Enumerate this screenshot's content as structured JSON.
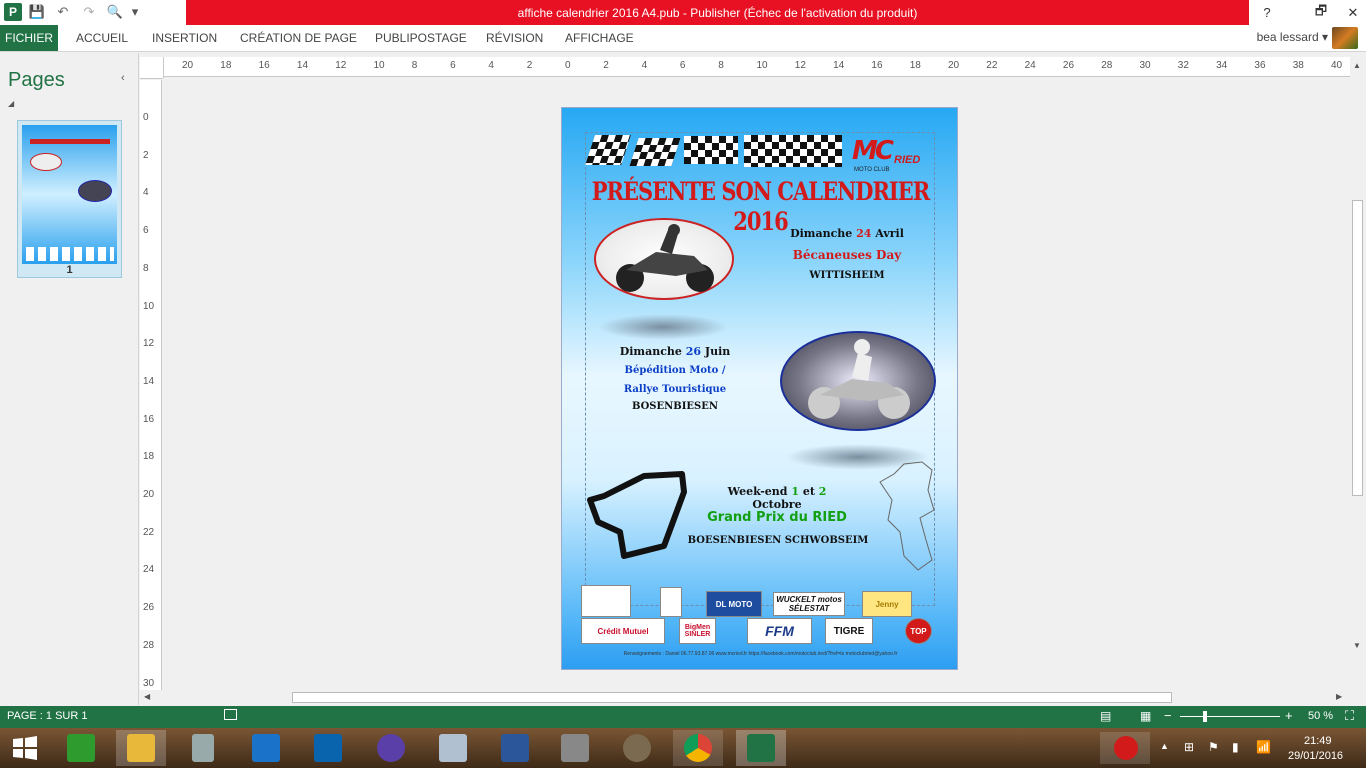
{
  "window": {
    "title": "affiche calendrier 2016 A4.pub -  Publisher (Échec de l'activation du produit)",
    "help": "?",
    "restore": "🗗",
    "minimize": "—",
    "maximize": "🗖",
    "close": "✕"
  },
  "qat": {
    "save": "💾",
    "undo": "↶",
    "redo": "↷",
    "preview": "🔍",
    "more": "▾"
  },
  "ribbon": {
    "tabs": [
      "FICHIER",
      "ACCUEIL",
      "INSERTION",
      "CRÉATION DE PAGE",
      "PUBLIPOSTAGE",
      "RÉVISION",
      "AFFICHAGE"
    ],
    "user": "bea lessard",
    "user_chevron": "▾"
  },
  "pages_pane": {
    "title": "Pages",
    "collapse": "‹",
    "expand_marker": "◢",
    "thumb_number": "1"
  },
  "rulers": {
    "h": [
      "20",
      "18",
      "16",
      "14",
      "12",
      "10",
      "8",
      "6",
      "4",
      "2",
      "0",
      "2",
      "4",
      "6",
      "8",
      "10",
      "12",
      "14",
      "16",
      "18",
      "20",
      "22",
      "24",
      "26",
      "28",
      "30",
      "32",
      "34",
      "36",
      "38",
      "40"
    ],
    "v": [
      "0",
      "2",
      "4",
      "6",
      "8",
      "10",
      "12",
      "14",
      "16",
      "18",
      "20",
      "22",
      "24",
      "26",
      "28",
      "30"
    ]
  },
  "poster": {
    "logo_text": "MC",
    "logo_sub": "RIED",
    "logo_caption": "MOTO CLUB",
    "title": "PRÉSENTE SON CALENDRIER 2016",
    "event1": {
      "date_pre": "Dimanche ",
      "date_num": "24",
      "date_post": " Avril",
      "name": "Bécaneuses Day",
      "place": "WITTISHEIM"
    },
    "event2": {
      "date_pre": "Dimanche ",
      "date_num": "26",
      "date_post": " Juin",
      "name1": "Bépédition Moto /",
      "name2": "Rallye Touristique",
      "place": "BOSENBIESEN"
    },
    "event3": {
      "date_pre": "Week-end ",
      "num1": "1",
      "mid": " et ",
      "num2": "2",
      "date_post": " Octobre",
      "name": "Grand Prix du RIED",
      "place": "BOESENBIESEN SCHWOBSEIM"
    },
    "sponsors_row1": [
      "",
      "",
      "DL MOTO",
      "WUCKELT motos SÉLESTAT",
      "Jenny"
    ],
    "sponsors_row2": [
      "Crédit Mutuel",
      "BigMen SINLER",
      "FFM",
      "TIGRE",
      "TOP"
    ],
    "footnote": "Renseignements : Daniel 06.77.93.87.06   www.mcried.fr   https://facebook.com/motoclub.ried/?fref=ts   motoclubried@yahoo.fr"
  },
  "status": {
    "page": "PAGE : 1 SUR 1",
    "zoom": "50 %",
    "zoom_minus": "−",
    "zoom_plus": "+"
  },
  "taskbar": {
    "time": "21:49",
    "date": "29/01/2016"
  },
  "colors": {
    "accent": "#217346",
    "title_red": "#e81123",
    "poster_red": "#d21a1a",
    "poster_blue": "#0b3fc7",
    "poster_green": "#12a012"
  }
}
